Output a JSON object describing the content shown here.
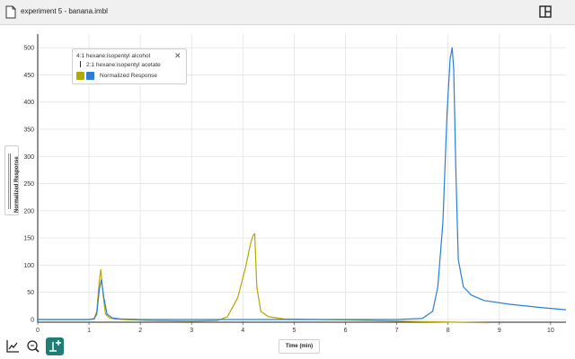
{
  "window": {
    "title": "experiment 5 - banana.imbl"
  },
  "icons": {
    "file": "file-icon",
    "layout": "split-layout-icon",
    "chart_tool": "line-chart-icon",
    "zoom_tool": "zoom-icon",
    "add_tool": "add-marker-icon"
  },
  "legend": {
    "series_1": "4:1 hexane:isopentyl alcohol",
    "series_2": "2:1 hexane:isopentyl acetate",
    "response_label": "Normalized Response"
  },
  "colors": {
    "series_1": "#b5a800",
    "series_2": "#2a7fd4",
    "tool_active": "#1e7e74"
  },
  "chart_data": {
    "type": "line",
    "xlabel": "Time (min)",
    "ylabel": "Normalized Response",
    "xlim": [
      0,
      10.3
    ],
    "ylim": [
      -5,
      525
    ],
    "xticks": [
      0,
      1,
      2,
      3,
      4,
      5,
      6,
      7,
      8,
      9,
      10
    ],
    "yticks": [
      0,
      50,
      100,
      150,
      200,
      250,
      300,
      350,
      400,
      450,
      500
    ],
    "grid": true,
    "legend_position": "top-left",
    "series": [
      {
        "name": "4:1 hexane:isopentyl alcohol",
        "x": [
          0,
          1.0,
          1.1,
          1.15,
          1.2,
          1.23,
          1.27,
          1.32,
          1.4,
          1.5,
          1.7,
          2.2,
          3.0,
          3.5,
          3.7,
          3.9,
          4.05,
          4.15,
          4.2,
          4.23,
          4.27,
          4.35,
          4.5,
          4.8,
          5.5,
          6.5,
          7.5,
          8.8
        ],
        "y": [
          0,
          0,
          2,
          15,
          70,
          92,
          50,
          10,
          3,
          1,
          0,
          -2,
          -3,
          -2,
          5,
          40,
          95,
          140,
          155,
          158,
          60,
          15,
          5,
          1,
          0,
          -2,
          -4,
          -6
        ]
      },
      {
        "name": "2:1 hexane:isopentyl acetate",
        "x": [
          0,
          1.0,
          1.1,
          1.15,
          1.2,
          1.24,
          1.29,
          1.35,
          1.45,
          1.6,
          2.0,
          3.0,
          4.0,
          5.0,
          6.0,
          7.0,
          7.5,
          7.7,
          7.8,
          7.9,
          7.98,
          8.04,
          8.08,
          8.11,
          8.15,
          8.2,
          8.3,
          8.45,
          8.7,
          9.2,
          9.8,
          10.3
        ],
        "y": [
          0,
          0,
          1,
          10,
          55,
          73,
          40,
          10,
          3,
          1,
          0,
          0,
          0,
          0,
          0,
          0,
          2,
          15,
          60,
          180,
          380,
          480,
          500,
          460,
          280,
          110,
          60,
          45,
          35,
          28,
          22,
          18
        ]
      }
    ]
  }
}
